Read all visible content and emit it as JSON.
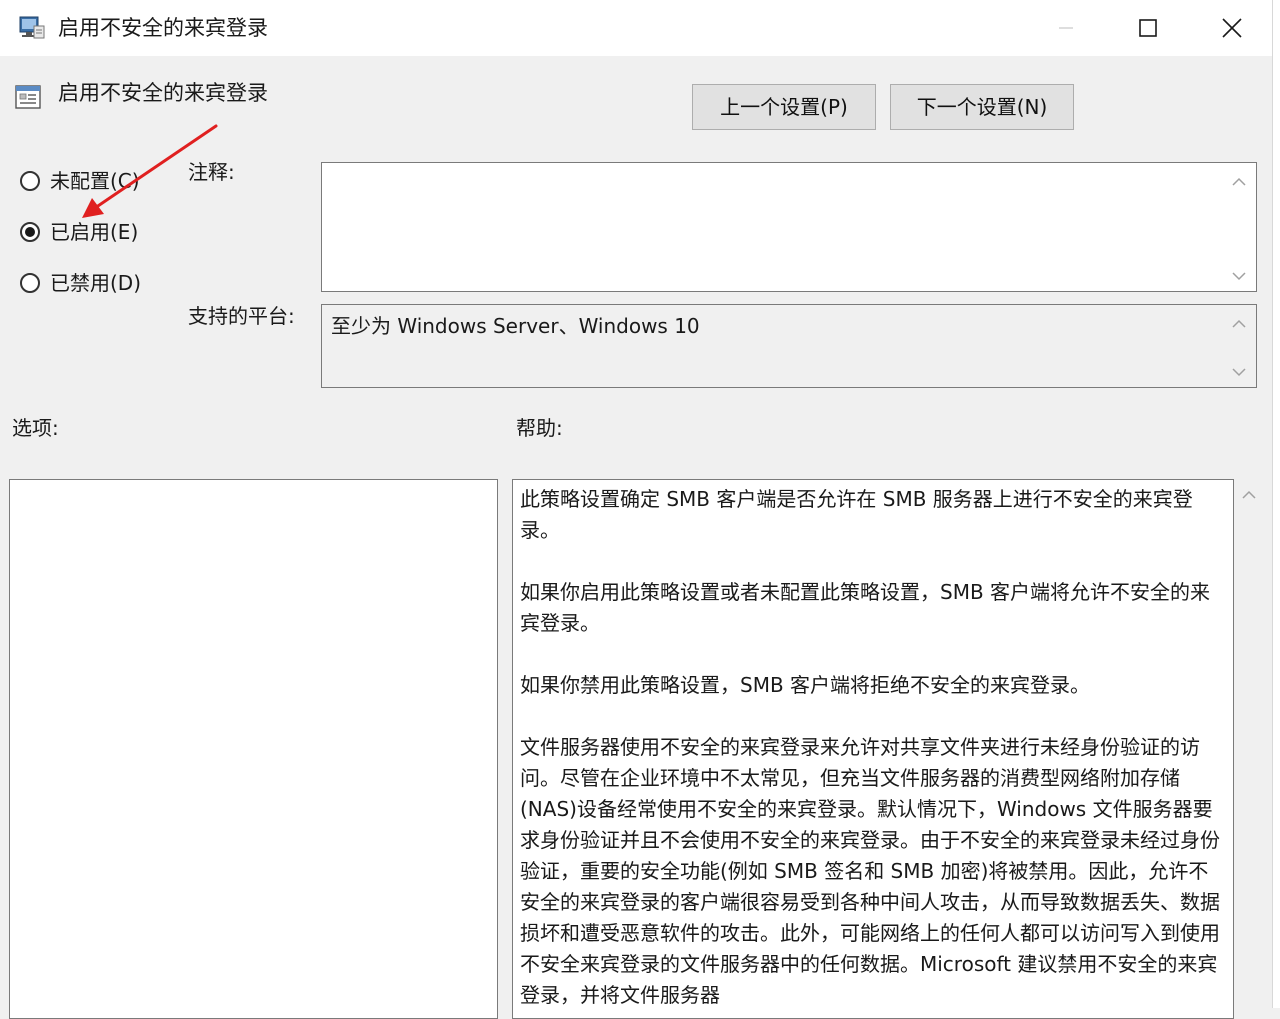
{
  "window": {
    "title": "启用不安全的来宾登录"
  },
  "header": {
    "policy_title": "启用不安全的来宾登录",
    "prev_button": "上一个设置(P)",
    "next_button": "下一个设置(N)"
  },
  "state": {
    "options": [
      {
        "label": "未配置(C)",
        "checked": false
      },
      {
        "label": "已启用(E)",
        "checked": true
      },
      {
        "label": "已禁用(D)",
        "checked": false
      }
    ]
  },
  "fields": {
    "comment_label": "注释:",
    "comment_value": "",
    "platform_label": "支持的平台:",
    "platform_value": "至少为 Windows Server、Windows 10",
    "options_label": "选项:",
    "help_label": "帮助:"
  },
  "help": {
    "paragraphs": [
      "此策略设置确定 SMB 客户端是否允许在 SMB 服务器上进行不安全的来宾登录。",
      "如果你启用此策略设置或者未配置此策略设置，SMB 客户端将允许不安全的来宾登录。",
      "如果你禁用此策略设置，SMB 客户端将拒绝不安全的来宾登录。",
      "文件服务器使用不安全的来宾登录来允许对共享文件夹进行未经身份验证的访问。尽管在企业环境中不太常见，但充当文件服务器的消费型网络附加存储(NAS)设备经常使用不安全的来宾登录。默认情况下，Windows 文件服务器要求身份验证并且不会使用不安全的来宾登录。由于不安全的来宾登录未经过身份验证，重要的安全功能(例如 SMB 签名和 SMB 加密)将被禁用。因此，允许不安全的来宾登录的客户端很容易受到各种中间人攻击，从而导致数据丢失、数据损坏和遭受恶意软件的攻击。此外，可能网络上的任何人都可以访问写入到使用不安全来宾登录的文件服务器中的任何数据。Microsoft 建议禁用不安全的来宾登录，并将文件服务器"
    ]
  },
  "colors": {
    "annotation_arrow": "#e02020"
  }
}
